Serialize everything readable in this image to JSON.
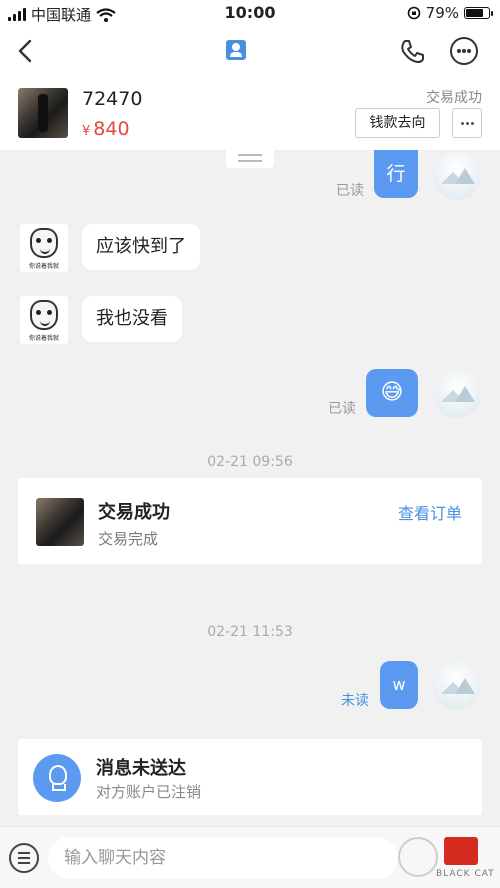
{
  "status_bar": {
    "carrier": "中国联通",
    "time": "10:00",
    "battery": "79%",
    "battery_level": 0.79
  },
  "product": {
    "title": "72470",
    "currency": "¥",
    "price": "840",
    "status": "交易成功",
    "money_button": "钱款去向"
  },
  "messages": {
    "m1_text": "行",
    "m1_status": "已读",
    "m2_text": "应该快到了",
    "m3_text": "我也没看",
    "m4_emoji": "😅",
    "m4_status": "已读",
    "m5_text": "w",
    "m5_status": "未读",
    "avatar_caption": "你说着我就"
  },
  "timestamps": {
    "t1": "02-21 09:56",
    "t2": "02-21 11:53"
  },
  "order_card": {
    "title": "交易成功",
    "subtitle": "交易完成",
    "link": "查看订单"
  },
  "notice_card": {
    "title": "消息未送达",
    "subtitle": "对方账户已注销"
  },
  "input": {
    "placeholder": "输入聊天内容"
  },
  "watermark": {
    "text": "BLACK CAT"
  },
  "colors": {
    "accent": "#5b9af0",
    "price": "#e24a3b",
    "link": "#4a90e2"
  }
}
